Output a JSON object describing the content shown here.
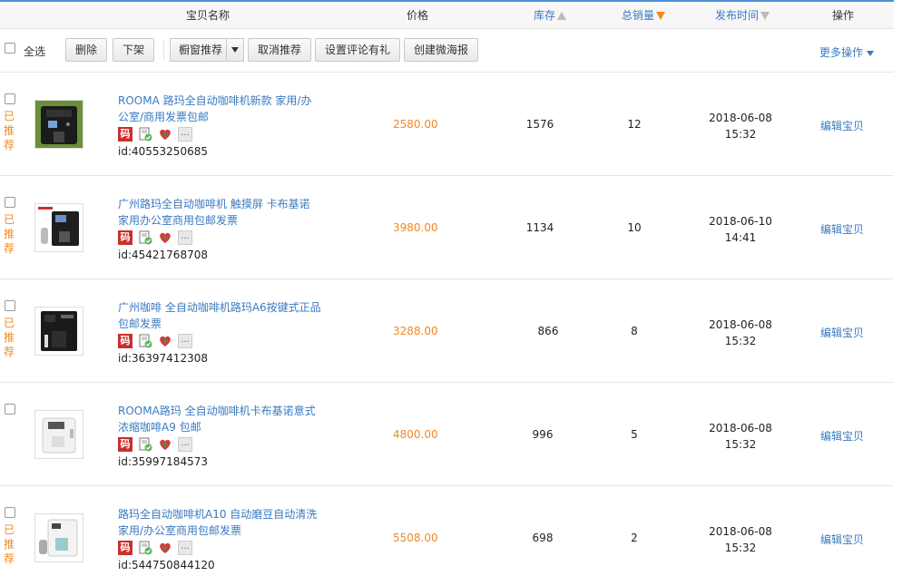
{
  "header": {
    "name": "宝贝名称",
    "price": "价格",
    "stock": "库存",
    "sales": "总销量",
    "date": "发布时间",
    "action": "操作"
  },
  "toolbar": {
    "select_all": "全选",
    "delete": "删除",
    "delist": "下架",
    "showcase": "橱窗推荐",
    "cancel_rec": "取消推荐",
    "review_gift": "设置评论有礼",
    "create_poster": "创建微海报",
    "more": "更多操作"
  },
  "rec_label": [
    "已",
    "推",
    "荐"
  ],
  "icon_code": "码",
  "edit_label": "编辑宝贝",
  "items": [
    {
      "title": "ROOMA 路玛全自动咖啡机新款 家用/办公室/商用发票包邮",
      "id": "id:40553250685",
      "price": "2580.00",
      "stock": "1576",
      "sales": "12",
      "date": "2018-06-08",
      "time": "15:32",
      "recommended": true
    },
    {
      "title": "广州路玛全自动咖啡机 触摸屏 卡布基诺 家用办公室商用包邮发票",
      "id": "id:45421768708",
      "price": "3980.00",
      "stock": "1134",
      "sales": "10",
      "date": "2018-06-10",
      "time": "14:41",
      "recommended": true
    },
    {
      "title": "广州咖啡 全自动咖啡机路玛A6按键式正品 包邮发票",
      "id": "id:36397412308",
      "price": "3288.00",
      "stock": "866",
      "sales": "8",
      "date": "2018-06-08",
      "time": "15:32",
      "recommended": true
    },
    {
      "title": "ROOMA路玛 全自动咖啡机卡布基诺意式浓缩咖啡A9 包邮",
      "id": "id:35997184573",
      "price": "4800.00",
      "stock": "996",
      "sales": "5",
      "date": "2018-06-08",
      "time": "15:32",
      "recommended": false
    },
    {
      "title": "路玛全自动咖啡机A10 自动磨豆自动清洗 家用/办公室商用包邮发票",
      "id": "id:544750844120",
      "price": "5508.00",
      "stock": "698",
      "sales": "2",
      "date": "2018-06-08",
      "time": "15:32",
      "recommended": true
    }
  ]
}
